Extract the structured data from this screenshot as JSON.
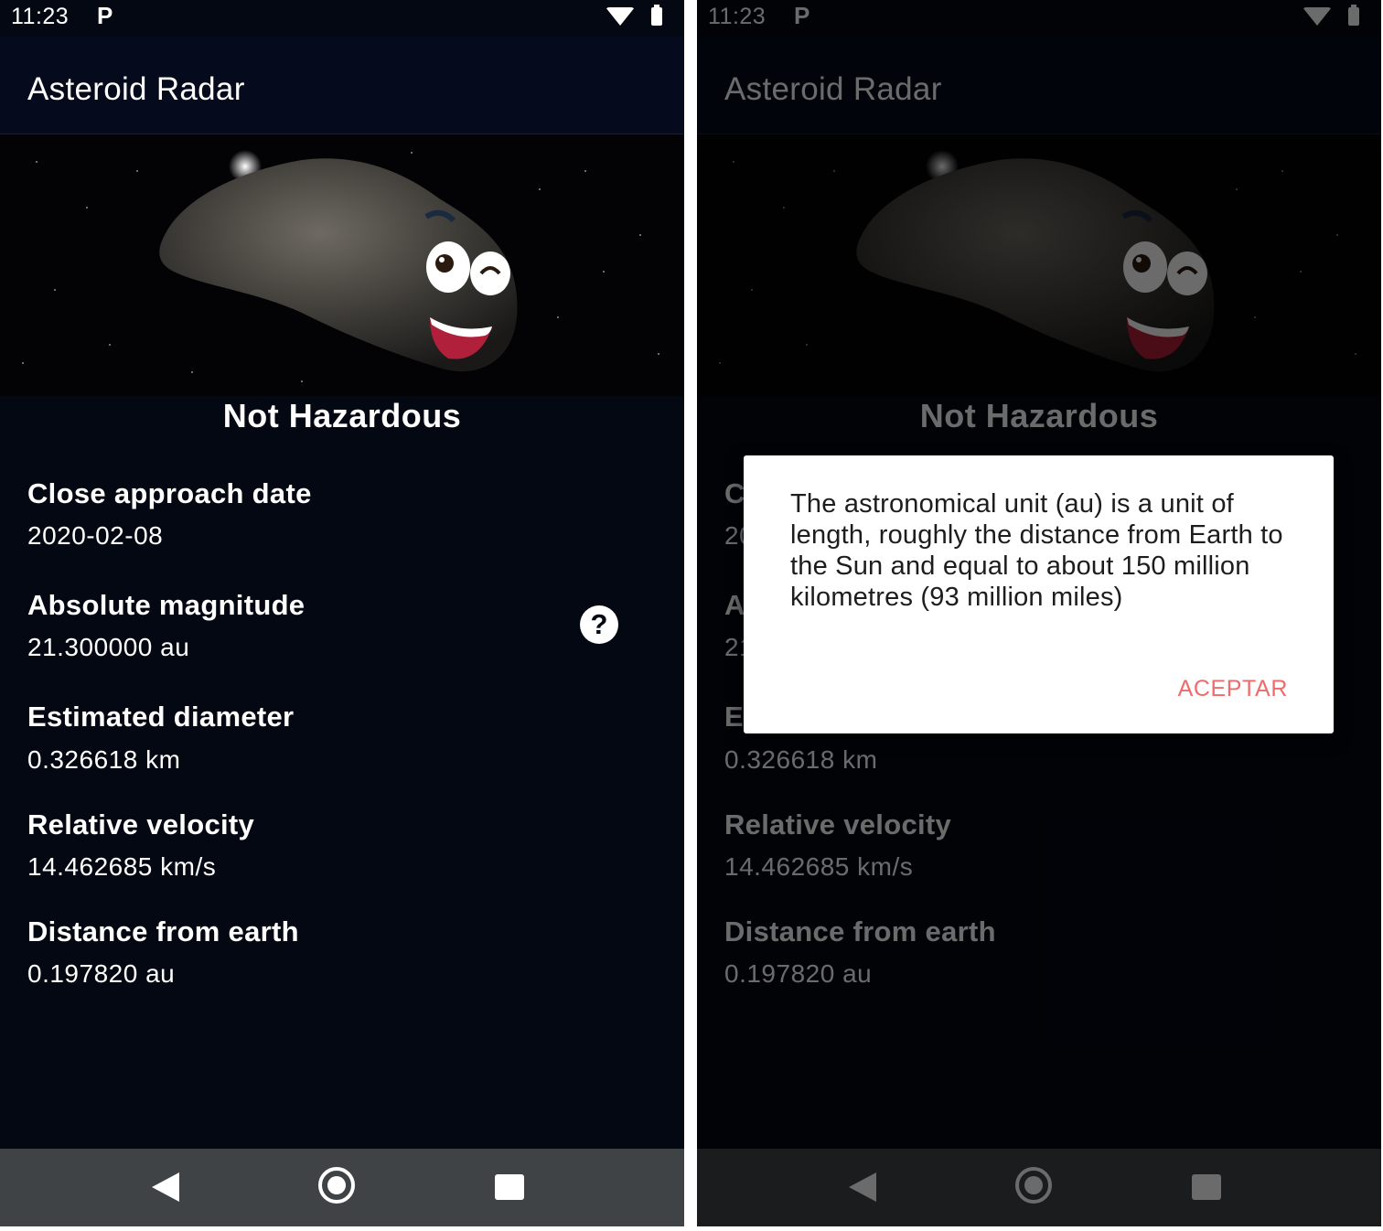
{
  "status_bar": {
    "time": "11:23",
    "notification": "P"
  },
  "app_bar": {
    "title": "Asteroid Radar"
  },
  "hero": {
    "image": "smiling-asteroid-image"
  },
  "hazard_status": "Not Hazardous",
  "details": [
    {
      "label": "Close approach date",
      "value": "2020-02-08"
    },
    {
      "label": "Absolute magnitude",
      "value": "21.300000 au"
    },
    {
      "label": "Estimated diameter",
      "value": "0.326618 km"
    },
    {
      "label": "Relative velocity",
      "value": "14.462685 km/s"
    },
    {
      "label": "Distance from earth",
      "value": "0.197820 au"
    }
  ],
  "help_icon": "?",
  "dialog": {
    "message": "The astronomical unit (au) is a unit of length, roughly the distance from Earth to the Sun and equal to about 150 million kilometres (93 million miles)",
    "button": "ACEPTAR"
  },
  "nav_bar": {
    "back": "back-icon",
    "home": "home-icon",
    "recents": "recents-icon"
  },
  "colors": {
    "background": "#030812",
    "text": "#ffffff",
    "dialog_button": "#ef6b6b",
    "nav_bar": "#3f4345"
  }
}
